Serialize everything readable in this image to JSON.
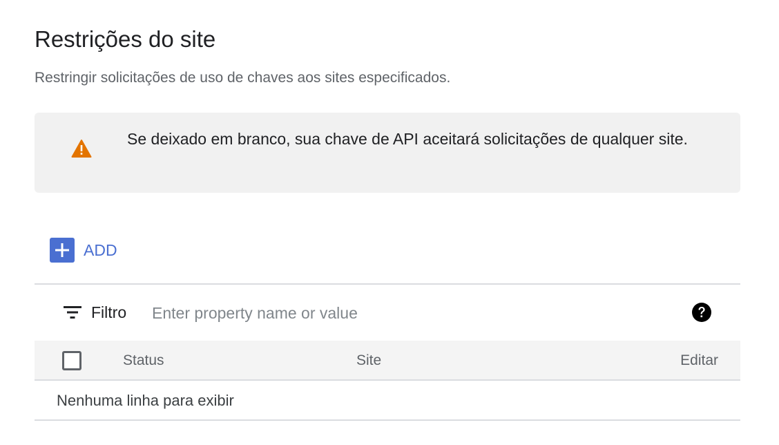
{
  "section": {
    "title": "Restrições do site",
    "description": "Restringir solicitações de uso de chaves aos sites especificados."
  },
  "warning": {
    "icon": "warning-triangle-icon",
    "color": "#e37400",
    "text": "Se deixado em branco, sua chave de API aceitará solicitações de qualquer site."
  },
  "toolbar": {
    "add_label": "ADD",
    "accent": "#4a6fd1"
  },
  "filter": {
    "label": "Filtro",
    "placeholder": "Enter property name or value",
    "value": ""
  },
  "table": {
    "columns": [
      "Status",
      "Site",
      "Editar"
    ],
    "rows": [],
    "empty_message": "Nenhuma linha para exibir"
  }
}
